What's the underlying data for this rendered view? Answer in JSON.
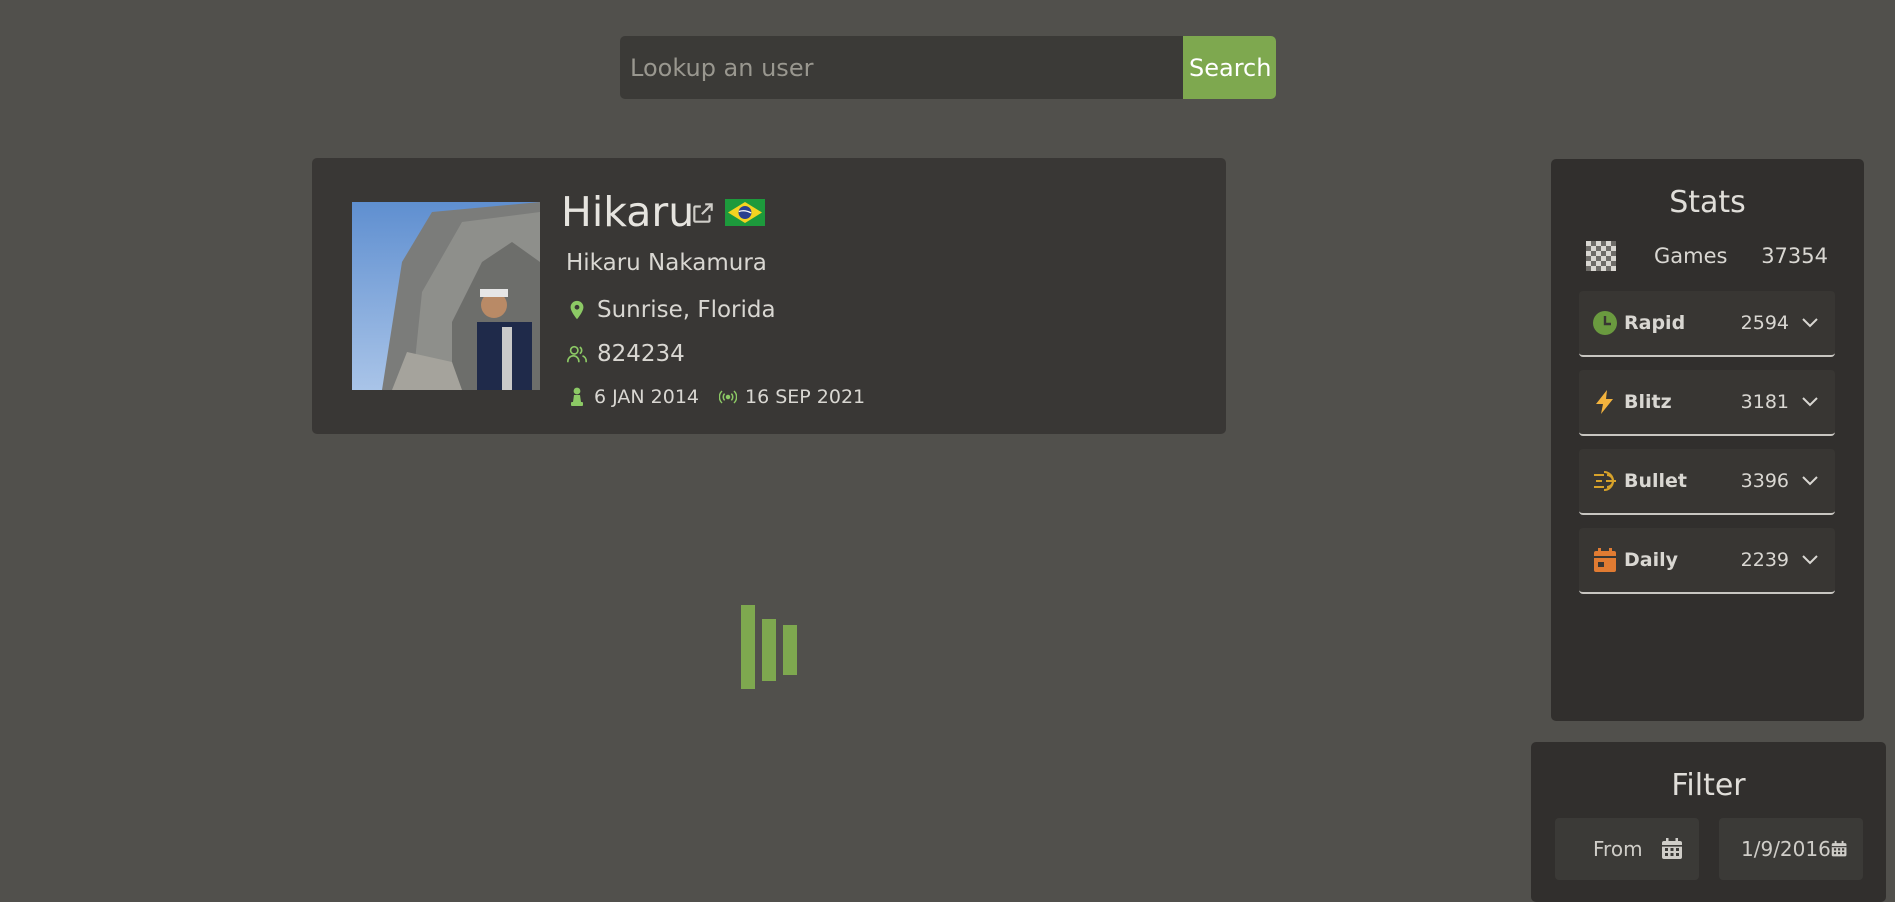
{
  "search": {
    "placeholder": "Lookup an user",
    "button_label": "Search"
  },
  "profile": {
    "username": "Hikaru",
    "name": "Hikaru Nakamura",
    "location": "Sunrise, Florida",
    "followers": "824234",
    "joined": "6 JAN 2014",
    "last_online": "16 SEP 2021",
    "flag": "brazil-flag"
  },
  "colors": {
    "accent": "#7ea84f",
    "background": "#51504c",
    "panel": "#393735"
  },
  "stats": {
    "title": "Stats",
    "games_label": "Games",
    "games_value": "37354",
    "ratings": [
      {
        "label": "Rapid",
        "value": "2594",
        "icon": "clock-icon",
        "color": "#6a9a3f"
      },
      {
        "label": "Blitz",
        "value": "3181",
        "icon": "lightning-icon",
        "color": "#f3b33d"
      },
      {
        "label": "Bullet",
        "value": "3396",
        "icon": "bullet-icon",
        "color": "#d7a22a"
      },
      {
        "label": "Daily",
        "value": "2239",
        "icon": "calendar-icon",
        "color": "#e07b32"
      }
    ]
  },
  "filter": {
    "title": "Filter",
    "from_value": "From",
    "to_value": "1/9/2016"
  }
}
